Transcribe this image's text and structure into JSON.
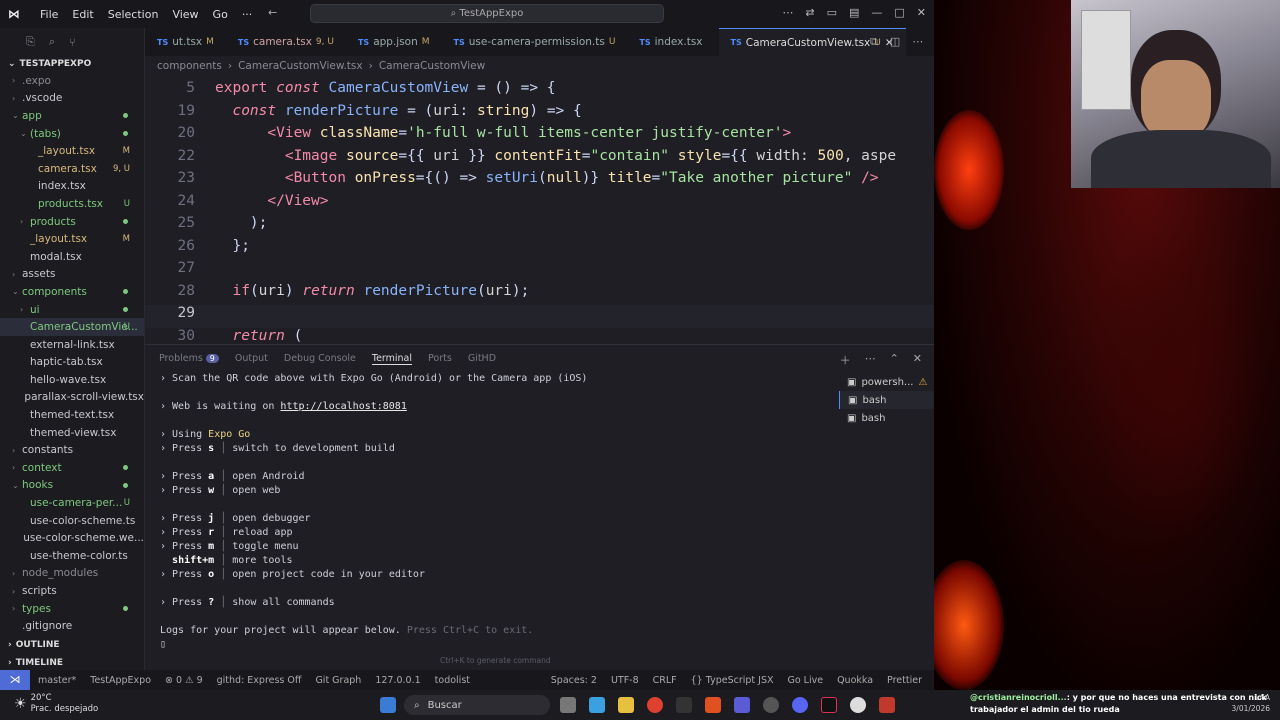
{
  "app": {
    "menu": [
      "File",
      "Edit",
      "Selection",
      "View",
      "Go",
      "···"
    ],
    "command_center": "TestAppExpo"
  },
  "explorer": {
    "project": "TESTAPPEXPO",
    "items": [
      {
        "label": ".expo",
        "indent": 1,
        "chev": "›",
        "cls": "dim"
      },
      {
        "label": ".vscode",
        "indent": 1,
        "chev": "›"
      },
      {
        "label": "app",
        "indent": 1,
        "chev": "⌄",
        "cls": "g",
        "dot": "#7ec97e"
      },
      {
        "label": "(tabs)",
        "indent": 2,
        "chev": "⌄",
        "cls": "g",
        "dot": "#7ec97e"
      },
      {
        "label": "_layout.tsx",
        "indent": 3,
        "cls": "y",
        "badge": "M"
      },
      {
        "label": "camera.tsx",
        "indent": 3,
        "cls": "y",
        "badge": "9, U"
      },
      {
        "label": "index.tsx",
        "indent": 3
      },
      {
        "label": "products.tsx",
        "indent": 3,
        "cls": "g",
        "badge": "U"
      },
      {
        "label": "products",
        "indent": 2,
        "chev": "›",
        "cls": "g",
        "dot": "#7ec97e"
      },
      {
        "label": "_layout.tsx",
        "indent": 2,
        "cls": "y",
        "badge": "M"
      },
      {
        "label": "modal.tsx",
        "indent": 2
      },
      {
        "label": "assets",
        "indent": 1,
        "chev": "›"
      },
      {
        "label": "components",
        "indent": 1,
        "chev": "⌄",
        "cls": "g",
        "dot": "#7ec97e"
      },
      {
        "label": "ui",
        "indent": 2,
        "chev": "›",
        "cls": "g",
        "dot": "#7ec97e"
      },
      {
        "label": "CameraCustomVie...",
        "indent": 2,
        "cls": "g",
        "badge": "U",
        "sel": true
      },
      {
        "label": "external-link.tsx",
        "indent": 2
      },
      {
        "label": "haptic-tab.tsx",
        "indent": 2
      },
      {
        "label": "hello-wave.tsx",
        "indent": 2
      },
      {
        "label": "parallax-scroll-view.tsx",
        "indent": 2
      },
      {
        "label": "themed-text.tsx",
        "indent": 2
      },
      {
        "label": "themed-view.tsx",
        "indent": 2
      },
      {
        "label": "constants",
        "indent": 1,
        "chev": "›"
      },
      {
        "label": "context",
        "indent": 1,
        "chev": "›",
        "cls": "g",
        "dot": "#7ec97e"
      },
      {
        "label": "hooks",
        "indent": 1,
        "chev": "⌄",
        "cls": "g",
        "dot": "#7ec97e"
      },
      {
        "label": "use-camera-per...",
        "indent": 2,
        "cls": "g",
        "badge": "U"
      },
      {
        "label": "use-color-scheme.ts",
        "indent": 2
      },
      {
        "label": "use-color-scheme.we...",
        "indent": 2
      },
      {
        "label": "use-theme-color.ts",
        "indent": 2
      },
      {
        "label": "node_modules",
        "indent": 1,
        "chev": "›",
        "cls": "dim"
      },
      {
        "label": "scripts",
        "indent": 1,
        "chev": "›"
      },
      {
        "label": "types",
        "indent": 1,
        "chev": "›",
        "cls": "g",
        "dot": "#7ec97e"
      },
      {
        "label": ".gitignore",
        "indent": 1
      }
    ],
    "outline": "OUTLINE",
    "timeline": "TIMELINE"
  },
  "tabs": [
    {
      "label": "ut.tsx",
      "mod": "M"
    },
    {
      "label": "camera.tsx",
      "mod": "9, U",
      "err": true
    },
    {
      "label": "app.json",
      "mod": "M"
    },
    {
      "label": "use-camera-permission.ts",
      "mod": "U"
    },
    {
      "label": "index.tsx",
      "mod": ""
    },
    {
      "label": "CameraCustomView.tsx",
      "mod": "U",
      "active": true
    }
  ],
  "breadcrumb": [
    "components",
    "›",
    "CameraCustomView.tsx",
    "›",
    "CameraCustomView"
  ],
  "code_lines": [
    {
      "n": "5",
      "html": "<span class='kw'>export</span> <span class='it'>const</span> <span class='fn'>CameraCustomView</span> <span class='pu'>= () =&gt; {</span>"
    },
    {
      "n": "19",
      "html": "  <span class='it'>const</span> <span class='fn'>renderPicture</span> <span class='pu'>= (</span>uri<span class='pu'>:</span> <span class='ty'>string</span><span class='pu'>) =&gt; {</span>"
    },
    {
      "n": "20",
      "html": "      <span class='tg'>&lt;View</span> <span class='at'>className</span><span class='pu'>=</span><span class='st'>'h-full w-full items-center justify-center'</span><span class='tg'>&gt;</span>"
    },
    {
      "n": "22",
      "html": "        <span class='tg'>&lt;Image</span> <span class='at'>source</span><span class='pu'>={{</span> uri <span class='pu'>}}</span> <span class='at'>contentFit</span><span class='pu'>=</span><span class='st'>\"contain\"</span> <span class='at'>style</span><span class='pu'>={{</span> width: <span class='ty'>500</span>, aspe"
    },
    {
      "n": "23",
      "html": "        <span class='tg'>&lt;Button</span> <span class='at'>onPress</span><span class='pu'>={() =&gt;</span> <span class='fn'>setUri</span><span class='pu'>(</span><span class='ty'>null</span><span class='pu'>)}</span> <span class='at'>title</span><span class='pu'>=</span><span class='st'>\"Take another picture\"</span> <span class='tg'>/&gt;</span>"
    },
    {
      "n": "24",
      "html": "      <span class='tg'>&lt;/View&gt;</span>"
    },
    {
      "n": "25",
      "html": "    <span class='pu'>);</span>"
    },
    {
      "n": "26",
      "html": "  <span class='pu'>};</span>"
    },
    {
      "n": "27",
      "html": ""
    },
    {
      "n": "28",
      "html": "  <span class='kw'>if</span><span class='pu'>(</span>uri<span class='pu'>)</span> <span class='it'>return</span> <span class='fn'>renderPicture</span><span class='pu'>(</span>uri<span class='pu'>);</span>"
    },
    {
      "n": "29",
      "html": "",
      "cur": true
    },
    {
      "n": "30",
      "html": "  <span class='it'>return</span> <span class='pu'>(</span>"
    }
  ],
  "panel": {
    "tabs": [
      "Problems",
      "Output",
      "Debug Console",
      "Terminal",
      "Ports",
      "GitHD"
    ],
    "problems_count": "9",
    "active_tab": "Terminal",
    "terminals": [
      "powersh...",
      "bash",
      "bash"
    ]
  },
  "terminal_lines": [
    "› Scan the QR code above with Expo Go (Android) or the Camera app (iOS)",
    "",
    "› Web is waiting on <span class='u'>http://localhost:8081</span>",
    "",
    "› Using <span style='color:#e9d586'>Expo Go</span>",
    "› Press <b>s</b> <span class='sep'>│</span> switch to development build",
    "",
    "› Press <b>a</b> <span class='sep'>│</span> open Android",
    "› Press <b>w</b> <span class='sep'>│</span> open web",
    "",
    "› Press <b>j</b> <span class='sep'>│</span> open debugger",
    "› Press <b>r</b> <span class='sep'>│</span> reload app",
    "› Press <b>m</b> <span class='sep'>│</span> toggle menu",
    "  <b>shift+m</b> <span class='sep'>│</span> more tools",
    "› Press <b>o</b> <span class='sep'>│</span> open project code in your editor",
    "",
    "› Press <b>?</b> <span class='sep'>│</span> show all commands",
    "",
    "Logs for your project will appear below. <span class='dimt'>Press Ctrl+C to exit.</span>",
    "▯"
  ],
  "terminal_hint": "Ctrl+K to generate command",
  "status": {
    "left": [
      "master*",
      "TestAppExpo",
      "⊗ 0 ⚠ 9",
      "githd: Express Off",
      "Git Graph",
      "127.0.0.1",
      "todolist"
    ],
    "right": [
      "Spaces: 2",
      "UTF-8",
      "CRLF",
      "{} TypeScript JSX",
      "Go Live",
      "Quokka",
      "Prettier"
    ]
  },
  "taskbar": {
    "temp": "20°C",
    "weather": "Prac. despejado",
    "search": "Buscar",
    "lang": "LAA",
    "date": "3/01/2026"
  },
  "chat": {
    "user": "@cristianreinocrioll...",
    "message": ": y por que no haces una entrevista con nick trabajador el admin del tio rueda"
  }
}
